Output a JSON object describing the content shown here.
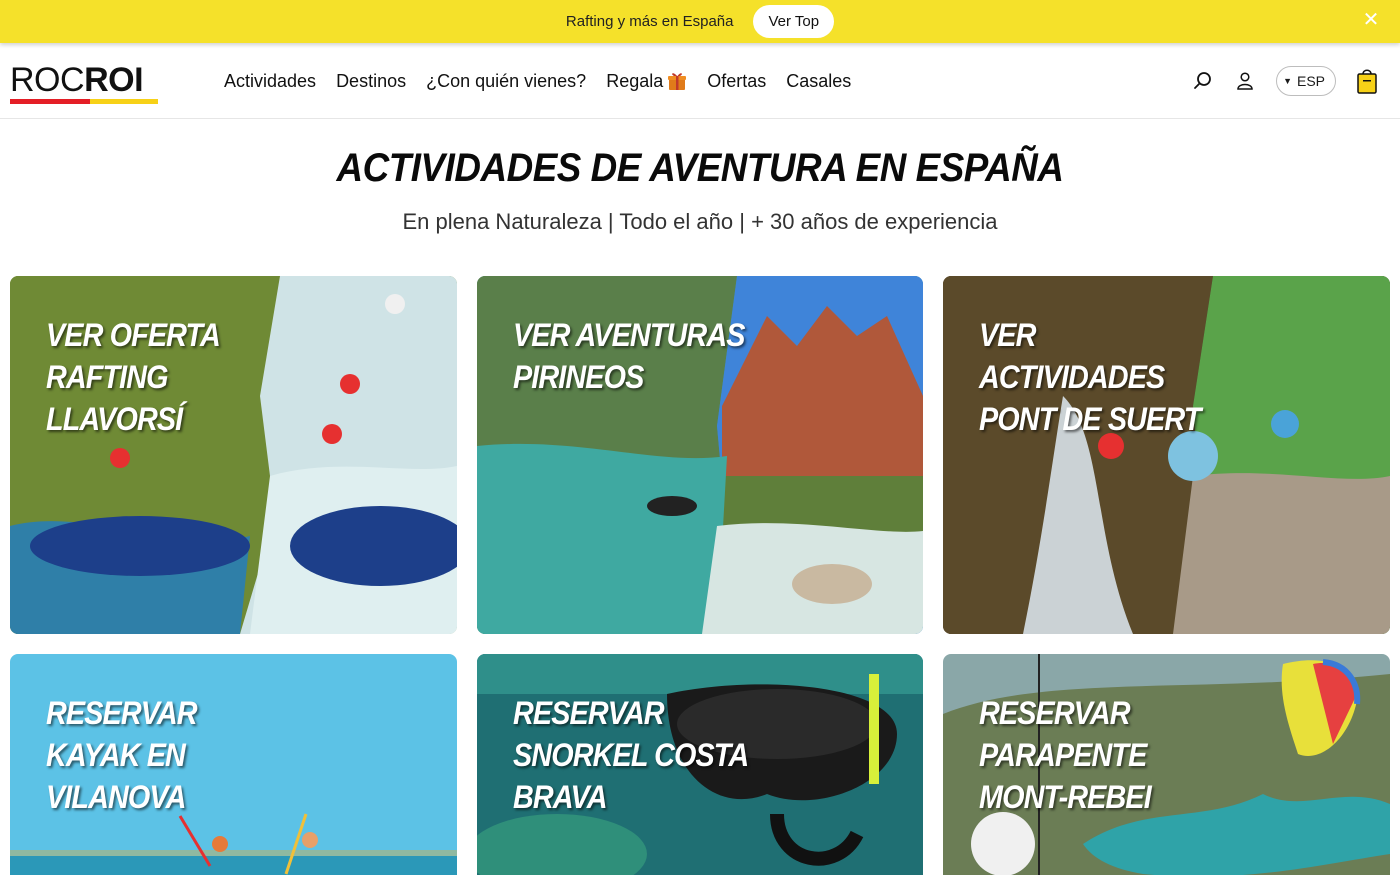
{
  "promo": {
    "text": "Rafting y más en España",
    "button_label": "Ver Top",
    "close_icon": "close-icon"
  },
  "header": {
    "logo": {
      "part1": "ROC",
      "part2": "ROI"
    },
    "nav": [
      {
        "label": "Actividades"
      },
      {
        "label": "Destinos"
      },
      {
        "label": "¿Con quién vienes?"
      },
      {
        "label": "Regala",
        "icon": "gift-icon"
      },
      {
        "label": "Ofertas"
      },
      {
        "label": "Casales"
      }
    ],
    "language": "ESP",
    "icons": [
      "search-icon",
      "user-icon",
      "cart-icon"
    ]
  },
  "hero": {
    "title": "ACTIVIDADES DE AVENTURA EN ESPAÑA",
    "subtitle": "En plena Naturaleza | Todo el año | + 30 años de experiencia"
  },
  "cards": [
    {
      "label": "VER OFERTA\nRAFTING\nLLAVORSÍ"
    },
    {
      "label": "VER AVENTURAS\nPIRINEOS"
    },
    {
      "label": "VER\nACTIVIDADES\nPONT DE SUERT"
    },
    {
      "label": "RESERVAR\nKAYAK EN\nVILANOVA"
    },
    {
      "label": "RESERVAR\nSNORKEL COSTA\nBRAVA"
    },
    {
      "label": "RESERVAR\nPARAPENTE\nMONT-REBEI"
    }
  ],
  "colors": {
    "promo_bg": "#f5e12a",
    "logo_red": "#e41e26",
    "logo_yellow": "#f7d117"
  }
}
